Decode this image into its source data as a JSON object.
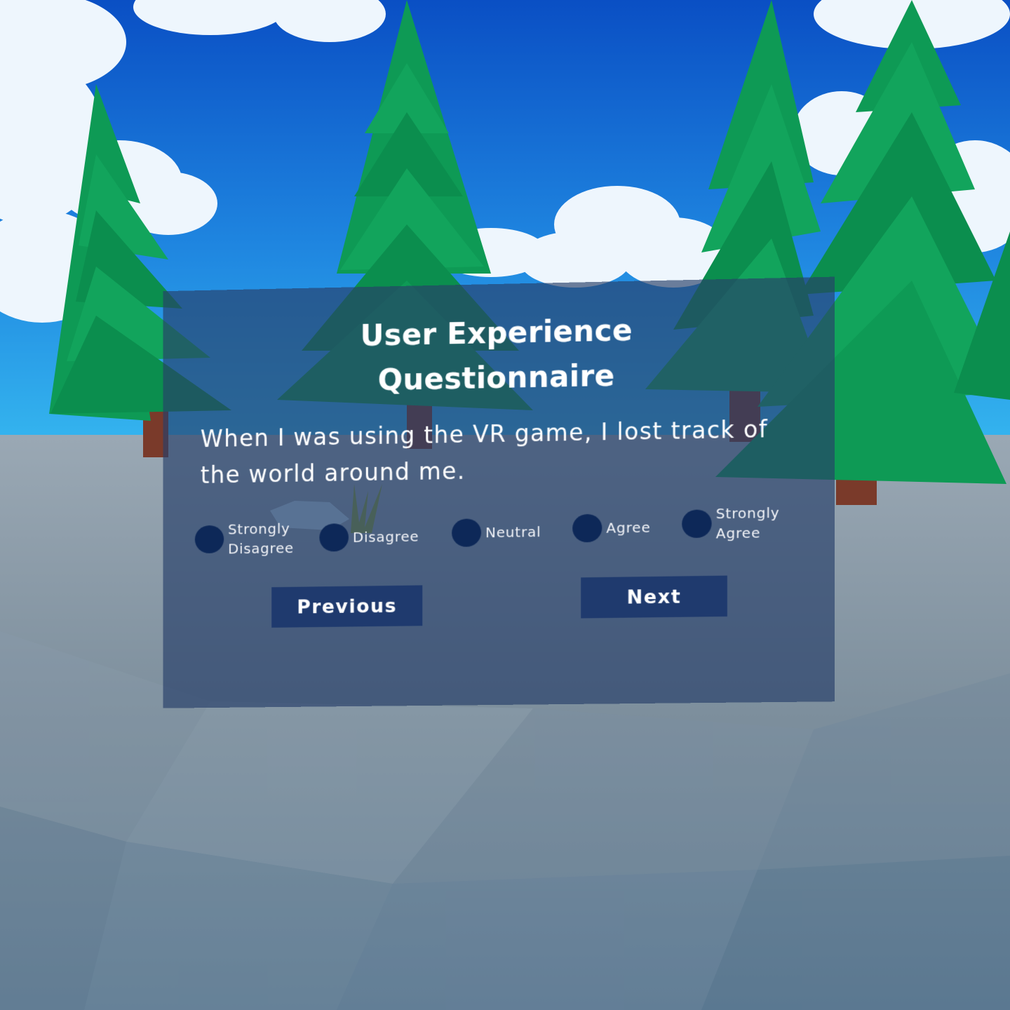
{
  "questionnaire": {
    "title_line1": "User Experience",
    "title_line2": "Questionnaire",
    "question": "When I was using the VR game, I lost track of the world around me.",
    "options": [
      {
        "label": "Strongly Disagree"
      },
      {
        "label": "Disagree"
      },
      {
        "label": "Neutral"
      },
      {
        "label": "Agree"
      },
      {
        "label": "Strongly Agree"
      }
    ],
    "previous_label": "Previous",
    "next_label": "Next"
  },
  "colors": {
    "sky": "#1a78d8",
    "ground": "#7a8c9a",
    "tree": "#0e9a55",
    "panel": "#263e69",
    "radio": "#0d2858",
    "button": "#1f3a6e"
  }
}
